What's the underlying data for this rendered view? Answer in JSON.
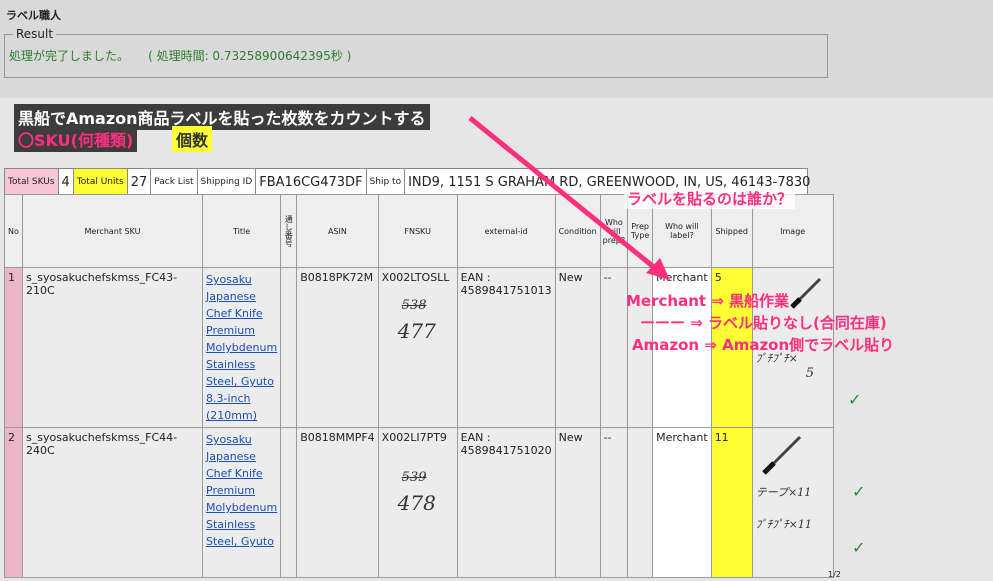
{
  "app": {
    "title": "ラベル職人"
  },
  "result": {
    "legend": "Result",
    "message": "処理が完了しました。     ( 処理時間: 0.73258900642395秒 )"
  },
  "annotations": {
    "line1": "黒船でAmazon商品ラベルを貼った枚数をカウントする",
    "line2a": "〇SKU(何種類)",
    "line2b": "個数",
    "q": "ラベルを貼るのは誰か？",
    "m1": "Merchant ⇒ 黒船作業",
    "m2": "ーーー ⇒ ラベル貼りなし(合同在庫)",
    "m3": "Amazon ⇒ Amazon側でラベル貼り",
    "pink_color": "#ff2f7d"
  },
  "summary": {
    "total_skus_label": "Total SKUs",
    "total_skus": "4",
    "total_units_label": "Total Units",
    "total_units": "27",
    "pack_list": "Pack List",
    "shipping_id_label": "Shipping ID",
    "shipping_id": "FBA16CG473DF",
    "ship_to_label": "Ship to",
    "ship_to": "IND9, 1151 S GRAHAM RD, GREENWOOD, IN, US, 46143-7830"
  },
  "table": {
    "headers": {
      "no": "No",
      "sku": "Merchant SKU",
      "title": "Title",
      "serial": "通し番号",
      "asin": "ASIN",
      "fnsku": "FNSKU",
      "extid": "external-id",
      "condition": "Condition",
      "who_prep": "Who will prep?",
      "prep_type": "Prep Type",
      "who_label": "Who will label?",
      "shipped": "Shipped",
      "image": "Image"
    },
    "rows": [
      {
        "no": "1",
        "sku": "s_syosakuchefskmss_FC43-210C",
        "title": "Syosaku Japanese Chef Knife Premium Molybdenum Stainless Steel, Gyuto 8.3-inch (210mm)",
        "asin": "B0818PK72M",
        "fnsku": "X002LTOSLL",
        "hw_strike": "538",
        "hw_num": "477",
        "extid": "EAN : 4589841751013",
        "condition": "New",
        "prep": "--",
        "who_label": "Merchant",
        "shipped": "5",
        "note": "ﾌﾟﾁﾌﾟﾁ×",
        "note_num": "5"
      },
      {
        "no": "2",
        "sku": "s_syosakuchefskmss_FC44-240C",
        "title": "Syosaku Japanese Chef Knife Premium Molybdenum Stainless Steel, Gyuto",
        "asin": "B0818MMPF4",
        "fnsku": "X002LI7PT9",
        "hw_strike": "539",
        "hw_num": "478",
        "extid": "EAN : 4589841751020",
        "condition": "New",
        "prep": "--",
        "who_label": "Merchant",
        "shipped": "11",
        "note": "テープ×11",
        "note2": "ﾌﾟﾁﾌﾟﾁ×11"
      }
    ]
  },
  "page": {
    "number": "1/2"
  }
}
